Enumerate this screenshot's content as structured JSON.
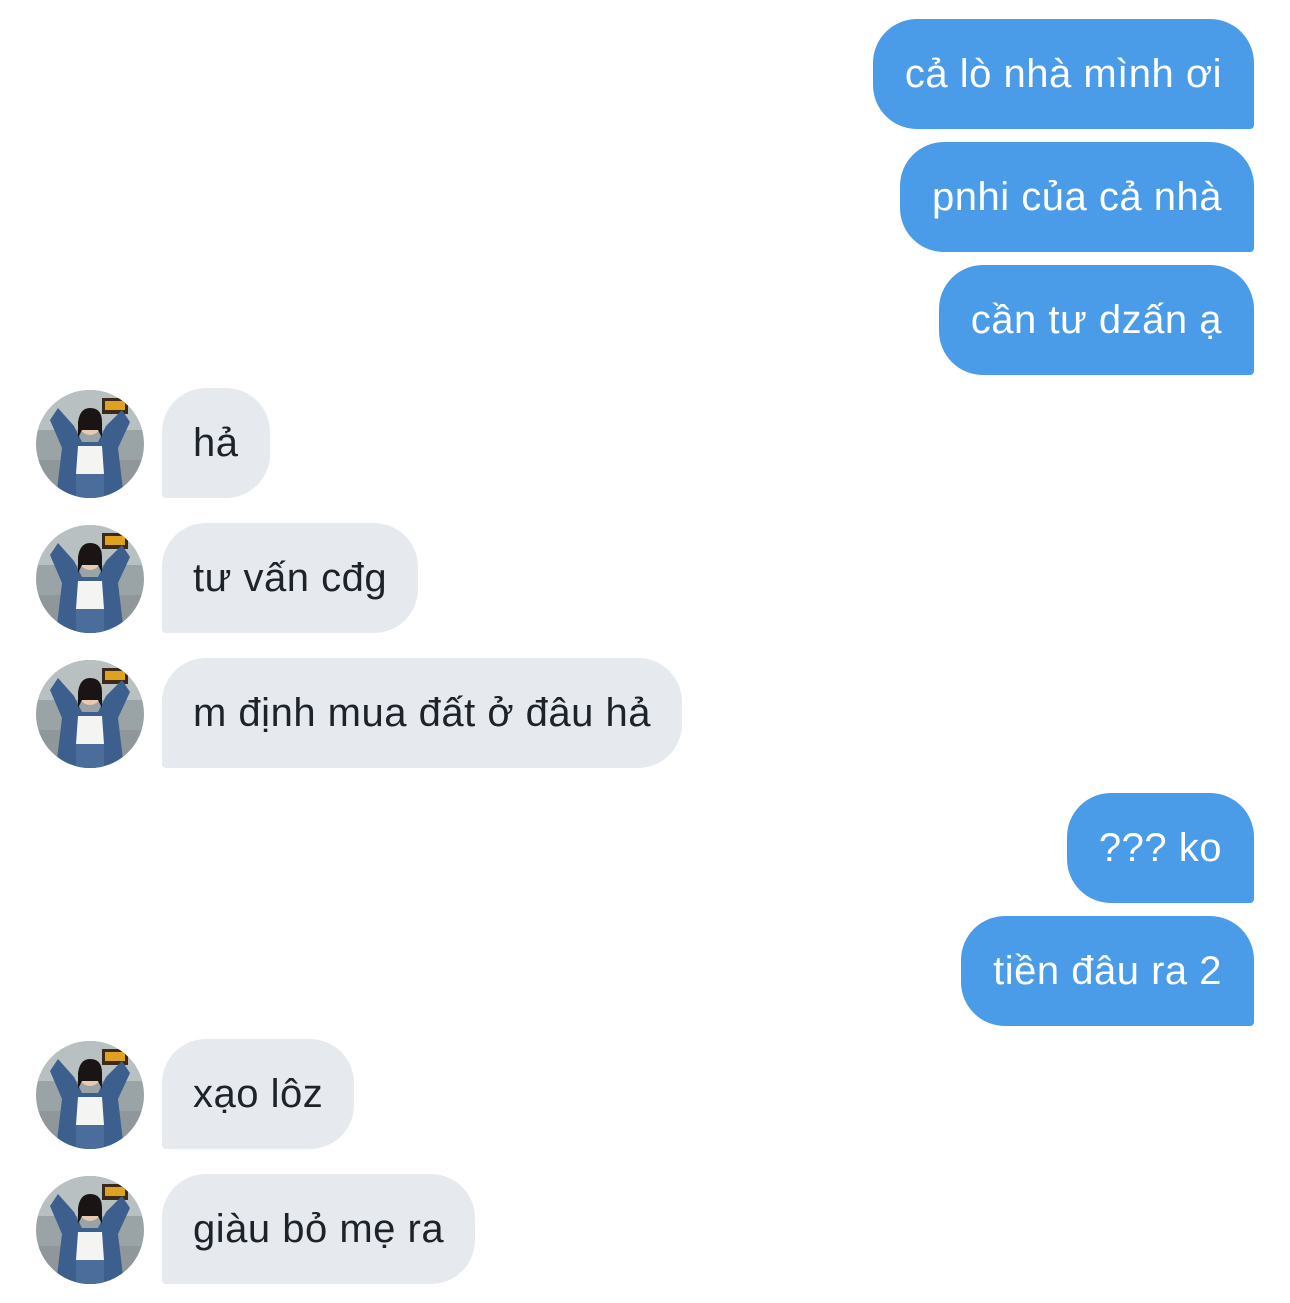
{
  "conversation": {
    "messages": [
      {
        "from": "me",
        "text": "cả lò nhà mình ơi"
      },
      {
        "from": "me",
        "text": "pnhi của cả nhà"
      },
      {
        "from": "me",
        "text": "cần tư dzấn ạ"
      },
      {
        "from": "them",
        "text": "hả"
      },
      {
        "from": "them",
        "text": "tư vấn cđg"
      },
      {
        "from": "them",
        "text": "m định mua đất ở đâu hả"
      },
      {
        "from": "me",
        "text": "??? ko"
      },
      {
        "from": "me",
        "text": "tiền đâu ra 2"
      },
      {
        "from": "them",
        "text": "xạo lôz"
      },
      {
        "from": "them",
        "text": "giàu bỏ mẹ ra"
      }
    ]
  },
  "colors": {
    "sent_bubble": "#4a9be8",
    "received_bubble": "#e6e9ee",
    "background": "#ffffff"
  },
  "icons": {
    "avatar": "contact-avatar-photo"
  }
}
